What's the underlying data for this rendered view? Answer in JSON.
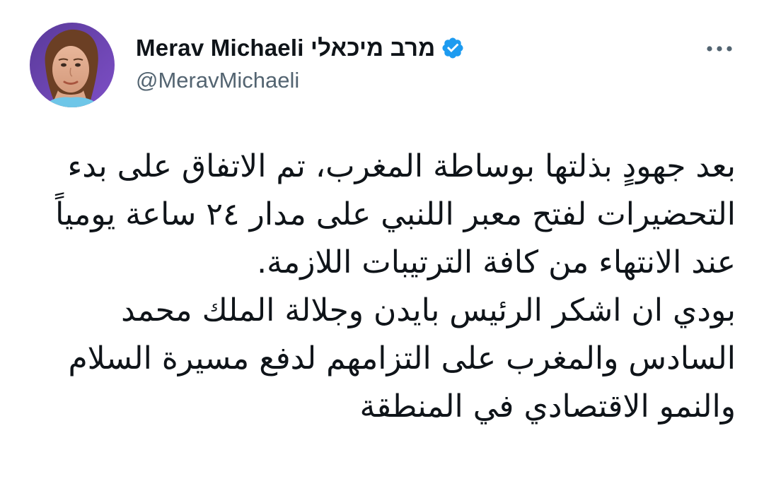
{
  "author": {
    "display_name": "Merav Michaeli מרב מיכאלי",
    "handle": "@MeravMichaeli",
    "avatar_icon": "profile-photo",
    "verified_icon": "verified-badge-icon",
    "verified_color": "#1d9bf0"
  },
  "menu": {
    "more_icon": "more-horizontal-icon"
  },
  "tweet": {
    "paragraphs": [
      "بعد جهودٍ بذلتها بوساطة المغرب، تم الاتفاق على بدء التحضيرات لفتح معبر اللنبي على مدار ٢٤ ساعة يومياً عند الانتهاء من كافة الترتيبات اللازمة.",
      "بودي ان اشكر الرئيس بايدن وجلالة الملك محمد السادس والمغرب على التزامهم لدفع مسيرة السلام والنمو الاقتصادي في المنطقة"
    ]
  },
  "colors": {
    "text_primary": "#0f1419",
    "text_secondary": "#536471",
    "background": "#ffffff"
  }
}
